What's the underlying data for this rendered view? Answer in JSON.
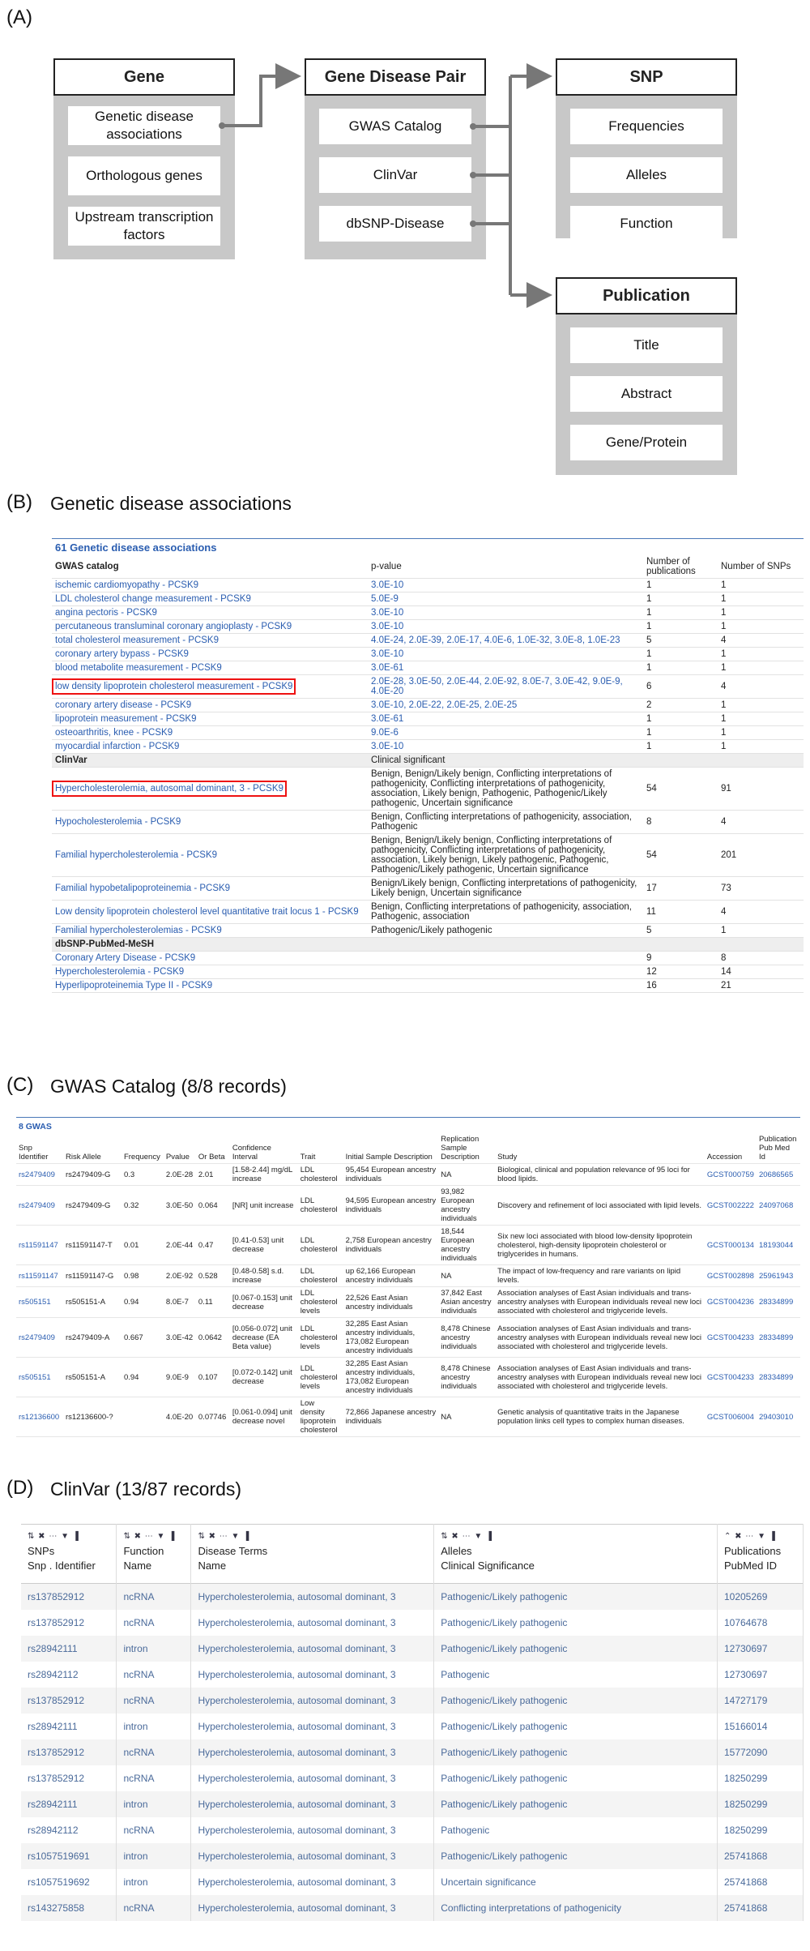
{
  "panels": {
    "a": "(A)",
    "b": "(B)",
    "c": "(C)",
    "d": "(D)"
  },
  "panel_a": {
    "gene": {
      "title": "Gene",
      "items": [
        "Genetic disease associations",
        "Orthologous genes",
        "Upstream transcription factors"
      ]
    },
    "pair": {
      "title": "Gene Disease Pair",
      "items": [
        "GWAS Catalog",
        "ClinVar",
        "dbSNP-Disease"
      ]
    },
    "snp": {
      "title": "SNP",
      "items": [
        "Frequencies",
        "Alleles",
        "Function"
      ]
    },
    "pub": {
      "title": "Publication",
      "items": [
        "Title",
        "Abstract",
        "Gene/Protein"
      ]
    }
  },
  "panel_b": {
    "title": "Genetic disease associations",
    "header": "61 Genetic disease associations",
    "col_pvalue": "p-value",
    "col_pubs": "Number of publications",
    "col_snps": "Number of SNPs",
    "gwas": {
      "label": "GWAS catalog",
      "rows": [
        {
          "name": "ischemic cardiomyopathy - PCSK9",
          "p": "3.0E-10",
          "pubs": "1",
          "snps": "1"
        },
        {
          "name": "LDL cholesterol change measurement - PCSK9",
          "p": "5.0E-9",
          "pubs": "1",
          "snps": "1"
        },
        {
          "name": "angina pectoris - PCSK9",
          "p": "3.0E-10",
          "pubs": "1",
          "snps": "1"
        },
        {
          "name": "percutaneous transluminal coronary angioplasty - PCSK9",
          "p": "3.0E-10",
          "pubs": "1",
          "snps": "1"
        },
        {
          "name": "total cholesterol measurement - PCSK9",
          "p": "4.0E-24, 2.0E-39, 2.0E-17, 4.0E-6, 1.0E-32, 3.0E-8, 1.0E-23",
          "pubs": "5",
          "snps": "4"
        },
        {
          "name": "coronary artery bypass - PCSK9",
          "p": "3.0E-10",
          "pubs": "1",
          "snps": "1"
        },
        {
          "name": "blood metabolite measurement - PCSK9",
          "p": "3.0E-61",
          "pubs": "1",
          "snps": "1"
        },
        {
          "name": "low density lipoprotein cholesterol measurement - PCSK9",
          "p": "2.0E-28, 3.0E-50, 2.0E-44, 2.0E-92, 8.0E-7, 3.0E-42, 9.0E-9, 4.0E-20",
          "pubs": "6",
          "snps": "4",
          "highlight": true
        },
        {
          "name": "coronary artery disease - PCSK9",
          "p": "3.0E-10, 2.0E-22, 2.0E-25, 2.0E-25",
          "pubs": "2",
          "snps": "1"
        },
        {
          "name": "lipoprotein measurement - PCSK9",
          "p": "3.0E-61",
          "pubs": "1",
          "snps": "1"
        },
        {
          "name": "osteoarthritis, knee - PCSK9",
          "p": "9.0E-6",
          "pubs": "1",
          "snps": "1"
        },
        {
          "name": "myocardial infarction - PCSK9",
          "p": "3.0E-10",
          "pubs": "1",
          "snps": "1"
        }
      ]
    },
    "clinvar": {
      "label": "ClinVar",
      "sub": "Clinical significant",
      "rows": [
        {
          "name": "Hypercholesterolemia, autosomal dominant, 3 - PCSK9",
          "p": "Benign, Benign/Likely benign, Conflicting interpretations of pathogenicity, Conflicting interpretations of pathogenicity, association, Likely benign, Pathogenic, Pathogenic/Likely pathogenic, Uncertain significance",
          "pubs": "54",
          "snps": "91",
          "highlight": true
        },
        {
          "name": "Hypocholesterolemia - PCSK9",
          "p": "Benign, Conflicting interpretations of pathogenicity, association, Pathogenic",
          "pubs": "8",
          "snps": "4"
        },
        {
          "name": "Familial hypercholesterolemia - PCSK9",
          "p": "Benign, Benign/Likely benign, Conflicting interpretations of pathogenicity, Conflicting interpretations of pathogenicity, association, Likely benign, Likely pathogenic, Pathogenic, Pathogenic/Likely pathogenic, Uncertain significance",
          "pubs": "54",
          "snps": "201"
        },
        {
          "name": "Familial hypobetalipoproteinemia - PCSK9",
          "p": "Benign/Likely benign, Conflicting interpretations of pathogenicity, Likely benign, Uncertain significance",
          "pubs": "17",
          "snps": "73"
        },
        {
          "name": "Low density lipoprotein cholesterol level quantitative trait locus 1 - PCSK9",
          "p": "Benign, Conflicting interpretations of pathogenicity, association, Pathogenic, association",
          "pubs": "11",
          "snps": "4"
        },
        {
          "name": "Familial hypercholesterolemias - PCSK9",
          "p": "Pathogenic/Likely pathogenic",
          "pubs": "5",
          "snps": "1"
        }
      ]
    },
    "dbsnp": {
      "label": "dbSNP-PubMed-MeSH",
      "rows": [
        {
          "name": "Coronary Artery Disease - PCSK9",
          "pubs": "9",
          "snps": "8"
        },
        {
          "name": "Hypercholesterolemia - PCSK9",
          "pubs": "12",
          "snps": "14"
        },
        {
          "name": "Hyperlipoproteinemia Type II - PCSK9",
          "pubs": "16",
          "snps": "21"
        }
      ]
    }
  },
  "panel_c": {
    "title": "GWAS Catalog (8/8 records)",
    "header": "8 GWAS",
    "columns": [
      "Snp Identifier",
      "Risk Allele",
      "Frequency",
      "Pvalue",
      "Or Beta",
      "Confidence Interval",
      "Trait",
      "Initial Sample Description",
      "Replication Sample Description",
      "Study",
      "Accession",
      "Publication Pub Med Id"
    ],
    "rows": [
      [
        "rs2479409",
        "rs2479409-G",
        "0.3",
        "2.0E-28",
        "2.01",
        "[1.58-2.44] mg/dL increase",
        "LDL cholesterol",
        "95,454 European ancestry individuals",
        "NA",
        "Biological, clinical and population relevance of 95 loci for blood lipids.",
        "GCST000759",
        "20686565"
      ],
      [
        "rs2479409",
        "rs2479409-G",
        "0.32",
        "3.0E-50",
        "0.064",
        "[NR] unit increase",
        "LDL cholesterol",
        "94,595 European ancestry individuals",
        "93,982 European ancestry individuals",
        "Discovery and refinement of loci associated with lipid levels.",
        "GCST002222",
        "24097068"
      ],
      [
        "rs11591147",
        "rs11591147-T",
        "0.01",
        "2.0E-44",
        "0.47",
        "[0.41-0.53] unit decrease",
        "LDL cholesterol",
        "2,758 European ancestry individuals",
        "18,544 European ancestry individuals",
        "Six new loci associated with blood low-density lipoprotein cholesterol, high-density lipoprotein cholesterol or triglycerides in humans.",
        "GCST000134",
        "18193044"
      ],
      [
        "rs11591147",
        "rs11591147-G",
        "0.98",
        "2.0E-92",
        "0.528",
        "[0.48-0.58] s.d. increase",
        "LDL cholesterol",
        "up 62,166 European ancestry individuals",
        "NA",
        "The impact of low-frequency and rare variants on lipid levels.",
        "GCST002898",
        "25961943"
      ],
      [
        "rs505151",
        "rs505151-A",
        "0.94",
        "8.0E-7",
        "0.11",
        "[0.067-0.153] unit decrease",
        "LDL cholesterol levels",
        "22,526 East Asian ancestry individuals",
        "37,842 East Asian ancestry individuals",
        "Association analyses of East Asian individuals and trans-ancestry analyses with European individuals reveal new loci associated with cholesterol and triglyceride levels.",
        "GCST004236",
        "28334899"
      ],
      [
        "rs2479409",
        "rs2479409-A",
        "0.667",
        "3.0E-42",
        "0.0642",
        "[0.056-0.072] unit decrease (EA Beta value)",
        "LDL cholesterol levels",
        "32,285 East Asian ancestry individuals, 173,082 European ancestry individuals",
        "8,478 Chinese ancestry individuals",
        "Association analyses of East Asian individuals and trans-ancestry analyses with European individuals reveal new loci associated with cholesterol and triglyceride levels.",
        "GCST004233",
        "28334899"
      ],
      [
        "rs505151",
        "rs505151-A",
        "0.94",
        "9.0E-9",
        "0.107",
        "[0.072-0.142] unit decrease",
        "LDL cholesterol levels",
        "32,285 East Asian ancestry individuals, 173,082 European ancestry individuals",
        "8,478 Chinese ancestry individuals",
        "Association analyses of East Asian individuals and trans-ancestry analyses with European individuals reveal new loci associated with cholesterol and triglyceride levels.",
        "GCST004233",
        "28334899"
      ],
      [
        "rs12136600",
        "rs12136600-?",
        "",
        "4.0E-20",
        "0.07746",
        "[0.061-0.094] unit decrease novel",
        "Low density lipoprotein cholesterol",
        "72,866 Japanese ancestry individuals",
        "NA",
        "Genetic analysis of quantitative traits in the Japanese population links cell types to complex human diseases.",
        "GCST006004",
        "29403010"
      ]
    ]
  },
  "panel_d": {
    "title": "ClinVar (13/87 records)",
    "controls": "⇅ ✖ ⋯ ▼ ▐",
    "controls_last": "⌃ ✖ ⋯ ▼ ▐",
    "columns": [
      {
        "top": "SNPs",
        "bottom": "Snp . Identifier"
      },
      {
        "top": "Function",
        "bottom": "Name"
      },
      {
        "top": "Disease Terms",
        "bottom": "Name"
      },
      {
        "top": "Alleles",
        "bottom": "Clinical Significance"
      },
      {
        "top": "Publications",
        "bottom": "PubMed ID"
      }
    ],
    "rows": [
      [
        "rs137852912",
        "ncRNA",
        "Hypercholesterolemia, autosomal dominant, 3",
        "Pathogenic/Likely pathogenic",
        "10205269"
      ],
      [
        "rs137852912",
        "ncRNA",
        "Hypercholesterolemia, autosomal dominant, 3",
        "Pathogenic/Likely pathogenic",
        "10764678"
      ],
      [
        "rs28942111",
        "intron",
        "Hypercholesterolemia, autosomal dominant, 3",
        "Pathogenic/Likely pathogenic",
        "12730697"
      ],
      [
        "rs28942112",
        "ncRNA",
        "Hypercholesterolemia, autosomal dominant, 3",
        "Pathogenic",
        "12730697"
      ],
      [
        "rs137852912",
        "ncRNA",
        "Hypercholesterolemia, autosomal dominant, 3",
        "Pathogenic/Likely pathogenic",
        "14727179"
      ],
      [
        "rs28942111",
        "intron",
        "Hypercholesterolemia, autosomal dominant, 3",
        "Pathogenic/Likely pathogenic",
        "15166014"
      ],
      [
        "rs137852912",
        "ncRNA",
        "Hypercholesterolemia, autosomal dominant, 3",
        "Pathogenic/Likely pathogenic",
        "15772090"
      ],
      [
        "rs137852912",
        "ncRNA",
        "Hypercholesterolemia, autosomal dominant, 3",
        "Pathogenic/Likely pathogenic",
        "18250299"
      ],
      [
        "rs28942111",
        "intron",
        "Hypercholesterolemia, autosomal dominant, 3",
        "Pathogenic/Likely pathogenic",
        "18250299"
      ],
      [
        "rs28942112",
        "ncRNA",
        "Hypercholesterolemia, autosomal dominant, 3",
        "Pathogenic",
        "18250299"
      ],
      [
        "rs1057519691",
        "intron",
        "Hypercholesterolemia, autosomal dominant, 3",
        "Pathogenic/Likely pathogenic",
        "25741868"
      ],
      [
        "rs1057519692",
        "intron",
        "Hypercholesterolemia, autosomal dominant, 3",
        "Uncertain significance",
        "25741868"
      ],
      [
        "rs143275858",
        "ncRNA",
        "Hypercholesterolemia, autosomal dominant, 3",
        "Conflicting interpretations of pathogenicity",
        "25741868"
      ]
    ]
  }
}
